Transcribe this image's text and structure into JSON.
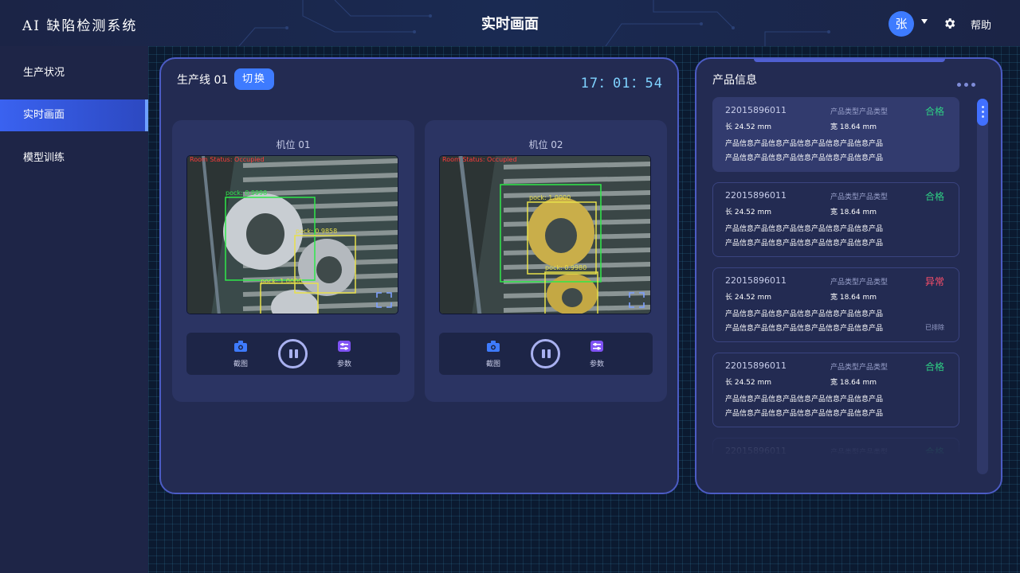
{
  "header": {
    "logo": "AI 缺陷检测系统",
    "title": "实时画面",
    "avatar_initial": "张",
    "help_label": "帮助"
  },
  "sidebar": {
    "items": [
      {
        "label": "生产状况",
        "active": false
      },
      {
        "label": "实时画面",
        "active": true
      },
      {
        "label": "模型训练",
        "active": false
      }
    ]
  },
  "main": {
    "line_title": "生产线 01",
    "switch_label": "切换",
    "clock": "17：01：54",
    "cameras": [
      {
        "title": "机位 01",
        "overlay_status": "Room Status: Occupied",
        "detections": [
          "pock: 0.9998",
          "pock: 0.9858",
          "pock: 1.0000"
        ],
        "capture_label": "截图",
        "params_label": "参数"
      },
      {
        "title": "机位 02",
        "overlay_status": "Room Status: Occupied",
        "detections": [
          "pock: 1.0000",
          "pock: 0.9980"
        ],
        "capture_label": "截图",
        "params_label": "参数"
      }
    ]
  },
  "products": {
    "title": "产品信息",
    "items": [
      {
        "id": "22015896011",
        "type": "产品类型产品类型",
        "status": "合格",
        "status_kind": "ok",
        "length": "长  24.52 mm",
        "width": "宽  18.64 mm",
        "info_line1": "产品信息产品信息产品信息产品信息产品信息产品",
        "info_line2": "产品信息产品信息产品信息产品信息产品信息产品",
        "note": ""
      },
      {
        "id": "22015896011",
        "type": "产品类型产品类型",
        "status": "合格",
        "status_kind": "ok",
        "length": "长  24.52 mm",
        "width": "宽  18.64 mm",
        "info_line1": "产品信息产品信息产品信息产品信息产品信息产品",
        "info_line2": "产品信息产品信息产品信息产品信息产品信息产品",
        "note": ""
      },
      {
        "id": "22015896011",
        "type": "产品类型产品类型",
        "status": "异常",
        "status_kind": "bad",
        "length": "长  24.52 mm",
        "width": "宽  18.64 mm",
        "info_line1": "产品信息产品信息产品信息产品信息产品信息产品",
        "info_line2": "产品信息产品信息产品信息产品信息产品信息产品",
        "note": "已排除"
      },
      {
        "id": "22015896011",
        "type": "产品类型产品类型",
        "status": "合格",
        "status_kind": "ok",
        "length": "长  24.52 mm",
        "width": "宽  18.64 mm",
        "info_line1": "产品信息产品信息产品信息产品信息产品信息产品",
        "info_line2": "产品信息产品信息产品信息产品信息产品信息产品",
        "note": ""
      },
      {
        "id": "22015896011",
        "type": "产品类型产品类型",
        "status": "合格",
        "status_kind": "ok",
        "length": "",
        "width": "",
        "info_line1": "",
        "info_line2": "",
        "note": ""
      }
    ]
  },
  "colors": {
    "accent": "#3e7bff",
    "ok": "#2ecf84",
    "bad": "#ff4f6a",
    "panel_border": "#4c5cc5"
  },
  "icons": {
    "settings": "gear-icon",
    "capture": "camera-icon",
    "params": "sliders-icon",
    "pause": "pause-icon",
    "expand": "expand-icon",
    "more": "more-dots-icon"
  }
}
